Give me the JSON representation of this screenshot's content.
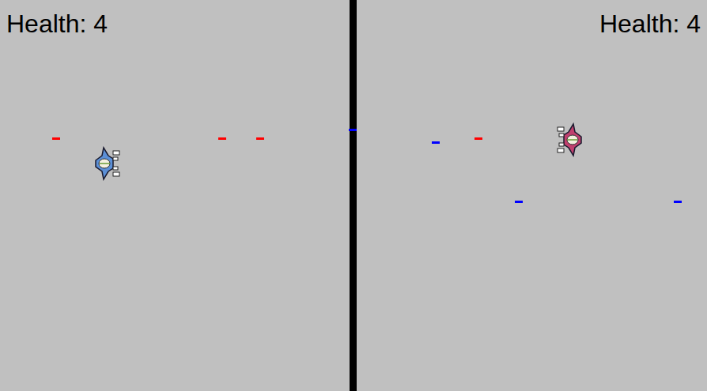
{
  "panels": [
    {
      "health": "Health: 4"
    },
    {
      "health": "Health: 4"
    }
  ],
  "ships": [
    {
      "color": "#5b8fd6"
    },
    {
      "color": "#c0406e"
    }
  ],
  "bullets": [
    {
      "color": "#ff0000"
    },
    {
      "color": "#ff0000"
    },
    {
      "color": "#ff0000"
    },
    {
      "color": "#ff0000"
    },
    {
      "color": "#0000ff"
    },
    {
      "color": "#0000ff"
    },
    {
      "color": "#0000ff"
    },
    {
      "color": "#0000ff"
    }
  ]
}
